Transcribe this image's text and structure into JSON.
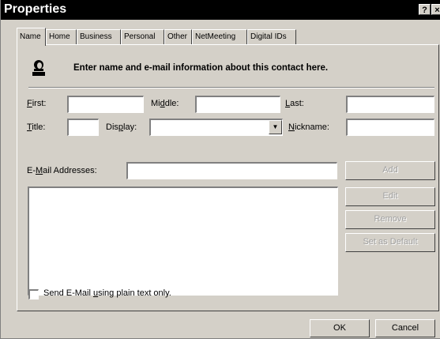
{
  "window": {
    "title": "Properties",
    "help_button": "?",
    "close_button": "×"
  },
  "tabs": [
    {
      "label": "Name",
      "active": true
    },
    {
      "label": "Home"
    },
    {
      "label": "Business"
    },
    {
      "label": "Personal"
    },
    {
      "label": "Other"
    },
    {
      "label": "NetMeeting"
    },
    {
      "label": "Digital IDs"
    }
  ],
  "header": {
    "icon": "contact-person-icon",
    "text": "Enter name and e-mail information about this contact here."
  },
  "fields": {
    "first": {
      "label_key": "F",
      "label_rest": "irst:",
      "value": ""
    },
    "middle": {
      "label_pre": "Mi",
      "label_key": "d",
      "label_rest": "dle:",
      "value": ""
    },
    "last": {
      "label_key": "L",
      "label_rest": "ast:",
      "value": ""
    },
    "title": {
      "label_key": "T",
      "label_rest": "itle:",
      "value": ""
    },
    "display": {
      "label_pre": "Dis",
      "label_key": "p",
      "label_rest": "lay:",
      "value": ""
    },
    "nickname": {
      "label_key": "N",
      "label_rest": "ickname:",
      "value": ""
    },
    "email": {
      "label_pre": "E-",
      "label_key": "M",
      "label_rest": "ail Addresses:",
      "value": ""
    }
  },
  "buttons": {
    "add": "Add",
    "edit": "Edit",
    "remove": "Remove",
    "set_default": "Set as Default",
    "ok": "OK",
    "cancel": "Cancel"
  },
  "plain_text": {
    "label_pre": "Send E-Mail ",
    "label_key": "u",
    "label_rest": "sing plain text only.",
    "checked": false
  }
}
